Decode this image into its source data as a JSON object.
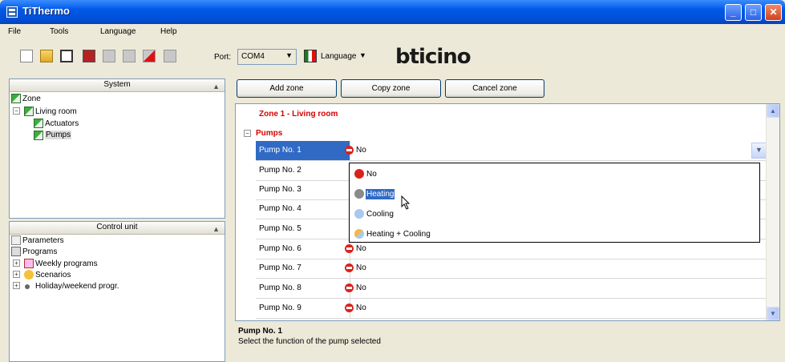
{
  "window": {
    "title": "TiThermo",
    "buttons": [
      "minimize",
      "maximize",
      "close"
    ]
  },
  "menu": [
    "File",
    "Tools",
    "Language",
    "Help"
  ],
  "toolbar": {
    "icons": [
      "new-file-icon",
      "open-folder-icon",
      "save-icon",
      "delete-icon",
      "disabled-icon",
      "disabled-icon",
      "send-icon",
      "disabled-icon"
    ],
    "port_label": "Port:",
    "port_value": "COM4",
    "language_label": "Language",
    "logo": "bticino"
  },
  "system_panel": {
    "title": "System",
    "tree": [
      {
        "label": "Zone",
        "level": 0
      },
      {
        "label": "Living room",
        "level": 1
      },
      {
        "label": "Actuators",
        "level": 2
      },
      {
        "label": "Pumps",
        "level": 2,
        "selected": true
      }
    ]
  },
  "control_panel": {
    "title": "Control unit",
    "tree": [
      {
        "label": "Parameters"
      },
      {
        "label": "Programs"
      },
      {
        "label": "Weekly programs"
      },
      {
        "label": "Scenarios"
      },
      {
        "label": "Holiday/weekend progr."
      }
    ]
  },
  "actions": {
    "add": "Add zone",
    "copy": "Copy zone",
    "cancel": "Cancel zone"
  },
  "grid": {
    "zone_title": "Zone 1 - Living room",
    "section": "Pumps",
    "rows": [
      {
        "label": "Pump No. 1",
        "value": "No"
      },
      {
        "label": "Pump No. 2",
        "value": ""
      },
      {
        "label": "Pump No. 3",
        "value": ""
      },
      {
        "label": "Pump No. 4",
        "value": ""
      },
      {
        "label": "Pump No. 5",
        "value": ""
      },
      {
        "label": "Pump No. 6",
        "value": "No"
      },
      {
        "label": "Pump No. 7",
        "value": "No"
      },
      {
        "label": "Pump No. 8",
        "value": "No"
      },
      {
        "label": "Pump No. 9",
        "value": "No"
      }
    ]
  },
  "dropdown_options": [
    "No",
    "Heating",
    "Cooling",
    "Heating + Cooling"
  ],
  "dropdown_highlighted": "Heating",
  "description": {
    "title": "Pump No. 1",
    "text": "Select the function of the pump selected"
  },
  "colors": {
    "title_blue": "#0058E6",
    "selection": "#316AC5",
    "section_red": "#d40000"
  }
}
